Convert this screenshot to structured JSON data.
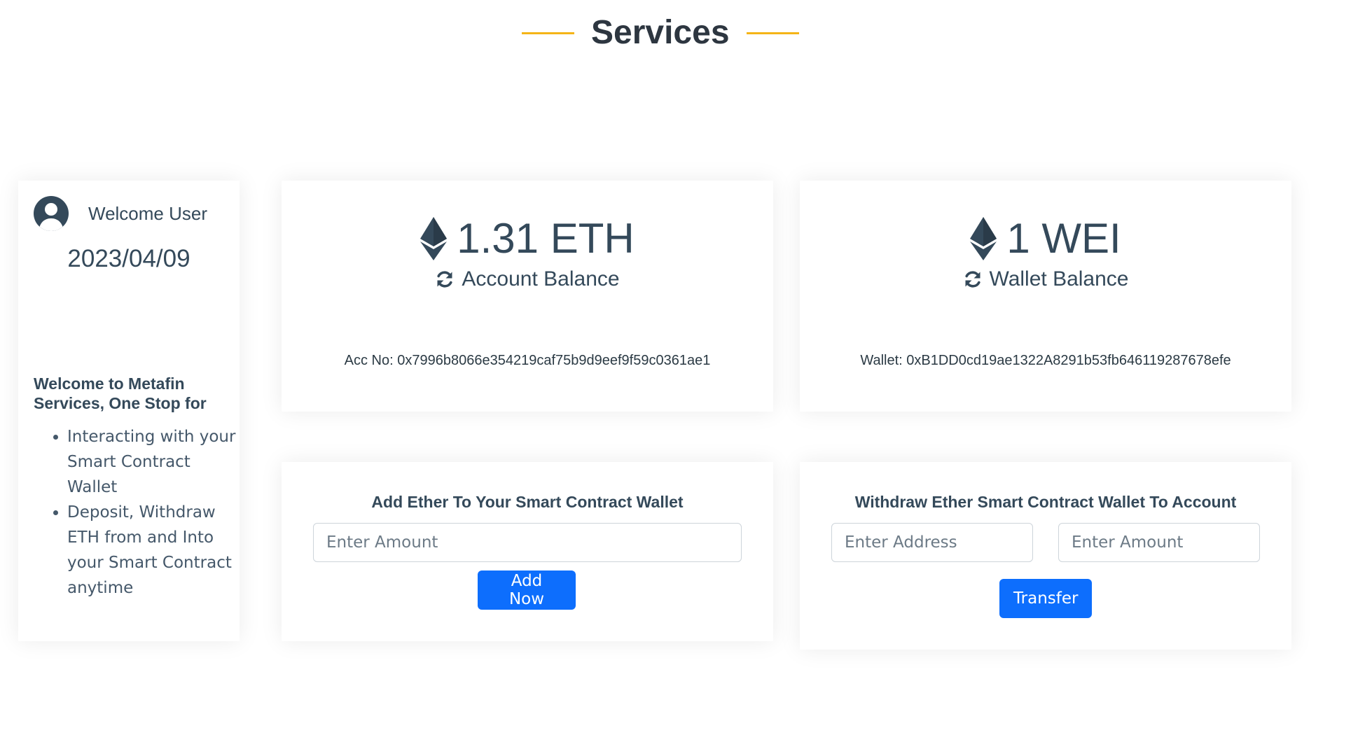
{
  "header": {
    "title": "Services",
    "accent_color": "#f5b417"
  },
  "profile": {
    "avatar_icon": "user-circle-icon",
    "welcome": "Welcome User",
    "date": "2023/04/09",
    "intro": "Welcome to Metafin Services, One Stop for",
    "features": [
      "Interacting with your Smart Contract Wallet",
      "Deposit, Withdraw ETH from and Into your Smart Contract anytime"
    ]
  },
  "account_balance": {
    "icon": "ethereum-icon",
    "amount": "1.31 ETH",
    "refresh_icon": "refresh-icon",
    "label": "Account Balance",
    "address": "Acc No: 0x7996b8066e354219caf75b9d9eef9f59c0361ae1"
  },
  "wallet_balance": {
    "icon": "ethereum-icon",
    "amount": "1 WEI",
    "refresh_icon": "refresh-icon",
    "label": "Wallet Balance",
    "address": "Wallet: 0xB1DD0cd19ae1322A8291b53fb646119287678efe"
  },
  "add_ether": {
    "title": "Add Ether To Your Smart Contract Wallet",
    "amount_placeholder": "Enter Amount",
    "amount_value": "",
    "button_label": "Add Now"
  },
  "withdraw_ether": {
    "title": "Withdraw Ether Smart Contract Wallet To Account",
    "address_placeholder": "Enter Address",
    "address_value": "",
    "amount_placeholder": "Enter Amount",
    "amount_value": "",
    "button_label": "Transfer"
  },
  "colors": {
    "primary_button": "#0d6efd",
    "text": "#34495a"
  }
}
